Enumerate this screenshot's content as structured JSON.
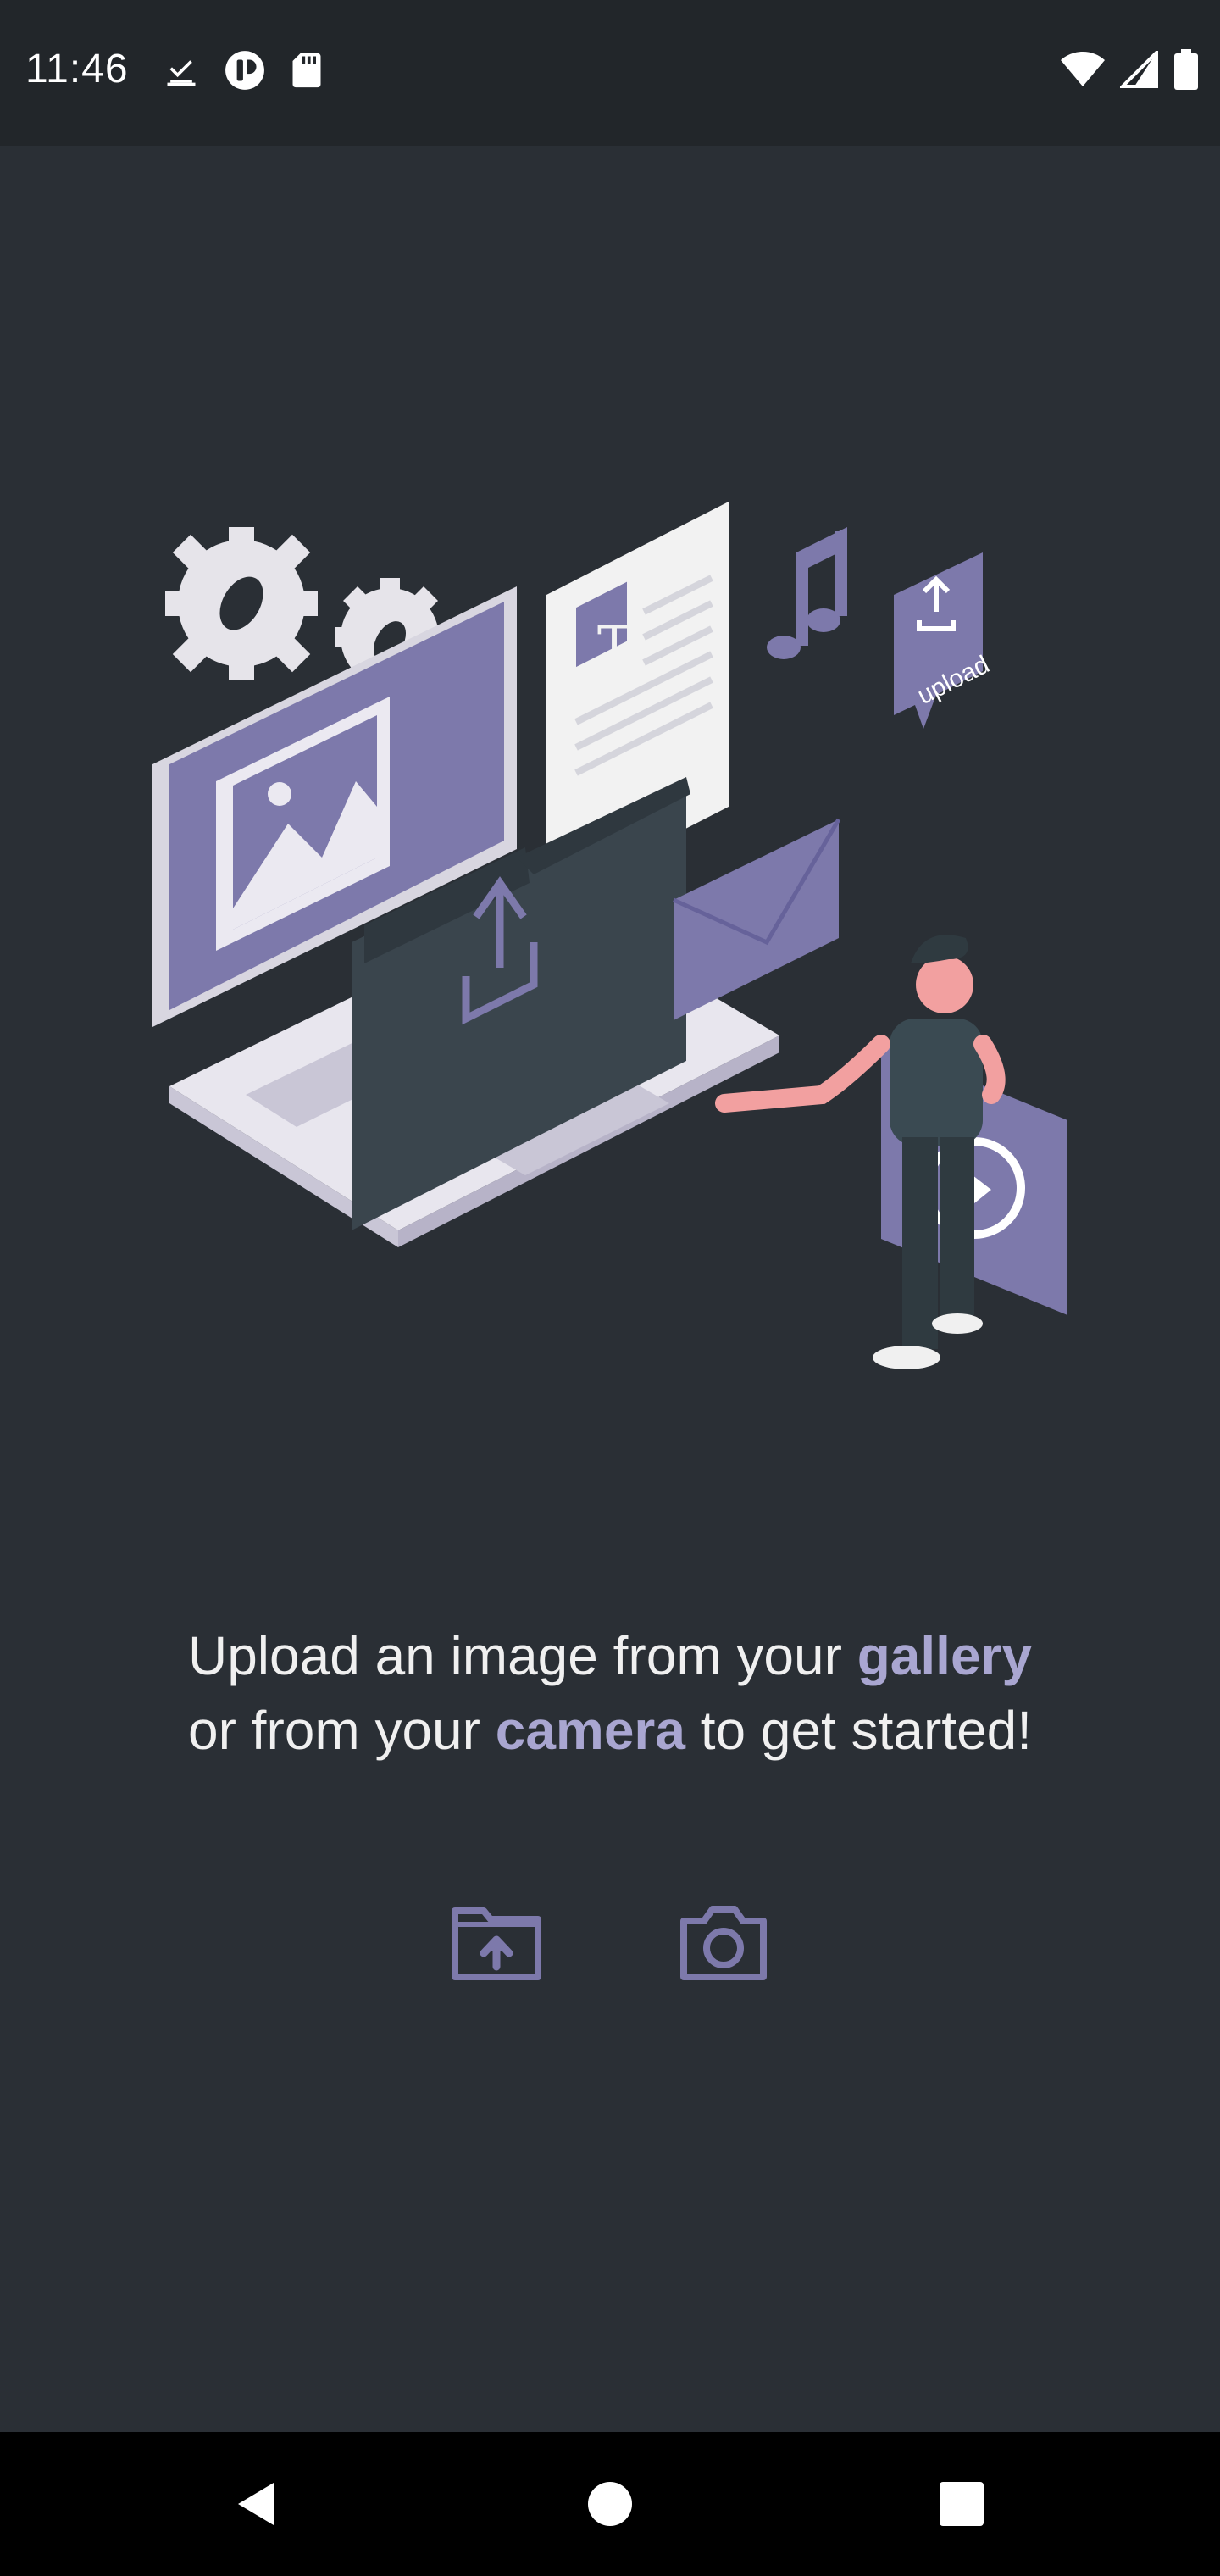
{
  "status_bar": {
    "time": "11:46",
    "left_icons": [
      "download-done-icon",
      "app-notification-icon",
      "sd-card-icon"
    ],
    "right_icons": [
      "wifi-icon",
      "cell-signal-icon",
      "battery-icon"
    ]
  },
  "illustration": {
    "upload_badge_text": "upload",
    "document_letter": "T"
  },
  "prompt": {
    "part1": "Upload an image from your ",
    "gallery": "gallery",
    "part2": "or from your ",
    "camera": "camera",
    "part3": " to get started!"
  },
  "actions": {
    "gallery_icon": "folder-upload-icon",
    "camera_icon": "camera-icon"
  },
  "nav_bar": {
    "buttons": [
      "back-icon",
      "home-icon",
      "recents-icon"
    ]
  },
  "colors": {
    "background": "#2a2f35",
    "status_bar": "#22262a",
    "accent": "#a9a6d1",
    "icon": "#7d79ab",
    "nav_bar": "#000000"
  }
}
